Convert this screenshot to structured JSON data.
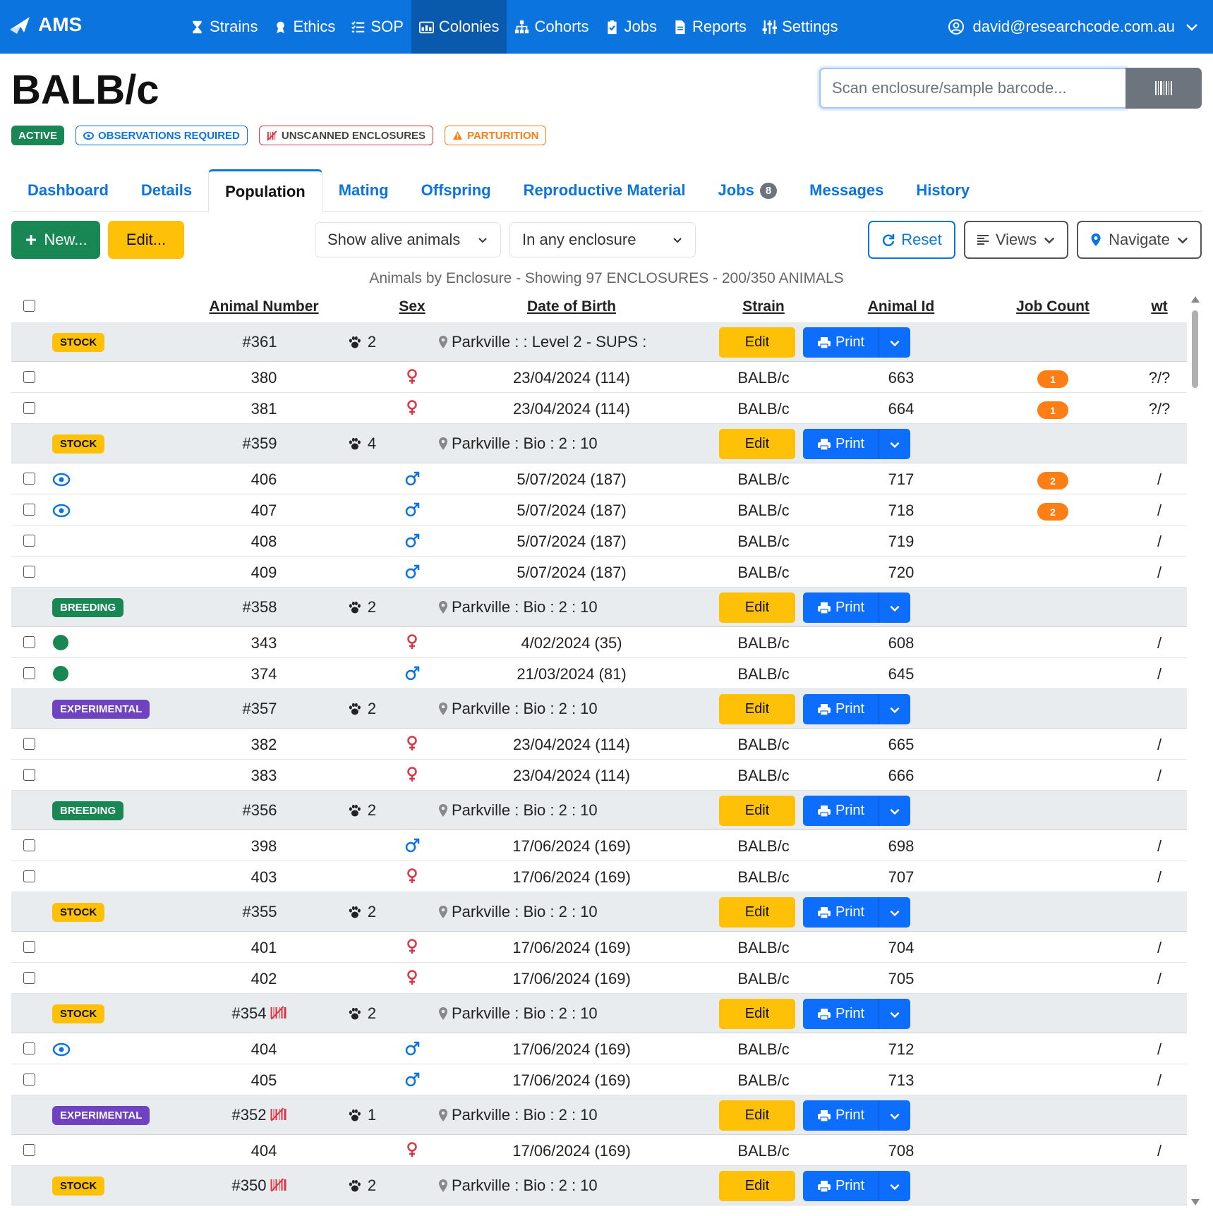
{
  "nav": {
    "brand": "AMS",
    "items": [
      {
        "label": "Strains",
        "icon": "hourglass-icon"
      },
      {
        "label": "Ethics",
        "icon": "award-icon"
      },
      {
        "label": "SOP",
        "icon": "list-check-icon"
      },
      {
        "label": "Colonies",
        "icon": "colony-icon"
      },
      {
        "label": "Cohorts",
        "icon": "sitemap-icon"
      },
      {
        "label": "Jobs",
        "icon": "clipboard-check-icon"
      },
      {
        "label": "Reports",
        "icon": "file-icon"
      },
      {
        "label": "Settings",
        "icon": "sliders-icon"
      }
    ],
    "active": "Colonies",
    "user": "david@researchcode.com.au"
  },
  "page": {
    "title": "BALB/c",
    "badges": {
      "active": "ACTIVE",
      "observations": "OBSERVATIONS REQUIRED",
      "unscanned": "UNSCANNED ENCLOSURES",
      "parturition": "PARTURITION"
    },
    "scan_placeholder": "Scan enclosure/sample barcode..."
  },
  "tabs": {
    "dashboard": "Dashboard",
    "details": "Details",
    "population": "Population",
    "mating": "Mating",
    "offspring": "Offspring",
    "repro": "Reproductive Material",
    "jobs": "Jobs",
    "jobs_count": "8",
    "messages": "Messages",
    "history": "History"
  },
  "toolbar": {
    "new": "New...",
    "edit": "Edit...",
    "filter_alive": "Show alive animals",
    "filter_enclosure": "In any enclosure",
    "reset": "Reset",
    "views": "Views",
    "navigate": "Navigate"
  },
  "caption": "Animals by Enclosure - Showing 97 ENCLOSURES - 200/350 ANIMALS",
  "columns": {
    "animal_number": "Animal Number",
    "sex": "Sex",
    "dob": "Date of Birth",
    "strain": "Strain",
    "animal_id": "Animal Id",
    "job_count": "Job Count",
    "wt": "wt"
  },
  "group_buttons": {
    "edit": "Edit",
    "print": "Print"
  },
  "colors": {
    "primary": "#0b74de",
    "success": "#198754",
    "warning": "#ffc107",
    "danger": "#dc3545",
    "orange": "#fd7e14",
    "purple": "#6f42c1"
  },
  "groups": [
    {
      "type": "STOCK",
      "enclosure": "#361",
      "count": "2",
      "location": "Parkville : : Level 2 - SUPS :",
      "unscanned": false,
      "animals": [
        {
          "number": "380",
          "sex": "female",
          "dob": "23/04/2024 (114)",
          "strain": "BALB/c",
          "id": "663",
          "jobs": "1",
          "wt": "?/?"
        },
        {
          "number": "381",
          "sex": "female",
          "dob": "23/04/2024 (114)",
          "strain": "BALB/c",
          "id": "664",
          "jobs": "1",
          "wt": "?/?"
        }
      ]
    },
    {
      "type": "STOCK",
      "enclosure": "#359",
      "count": "4",
      "location": "Parkville : Bio : 2 : 10",
      "unscanned": false,
      "animals": [
        {
          "number": "406",
          "sex": "male",
          "dob": "5/07/2024 (187)",
          "strain": "BALB/c",
          "id": "717",
          "jobs": "2",
          "wt": "/",
          "flag": "eye"
        },
        {
          "number": "407",
          "sex": "male",
          "dob": "5/07/2024 (187)",
          "strain": "BALB/c",
          "id": "718",
          "jobs": "2",
          "wt": "/",
          "flag": "eye"
        },
        {
          "number": "408",
          "sex": "male",
          "dob": "5/07/2024 (187)",
          "strain": "BALB/c",
          "id": "719",
          "jobs": "",
          "wt": "/"
        },
        {
          "number": "409",
          "sex": "male",
          "dob": "5/07/2024 (187)",
          "strain": "BALB/c",
          "id": "720",
          "jobs": "",
          "wt": "/"
        }
      ]
    },
    {
      "type": "BREEDING",
      "enclosure": "#358",
      "count": "2",
      "location": "Parkville : Bio : 2 : 10",
      "unscanned": false,
      "animals": [
        {
          "number": "343",
          "sex": "female",
          "dob": "4/02/2024 (35)",
          "strain": "BALB/c",
          "id": "608",
          "jobs": "",
          "wt": "/",
          "flag": "dot"
        },
        {
          "number": "374",
          "sex": "male",
          "dob": "21/03/2024 (81)",
          "strain": "BALB/c",
          "id": "645",
          "jobs": "",
          "wt": "/",
          "flag": "dot"
        }
      ]
    },
    {
      "type": "EXPERIMENTAL",
      "enclosure": "#357",
      "count": "2",
      "location": "Parkville : Bio : 2 : 10",
      "unscanned": false,
      "animals": [
        {
          "number": "382",
          "sex": "female",
          "dob": "23/04/2024 (114)",
          "strain": "BALB/c",
          "id": "665",
          "jobs": "",
          "wt": "/"
        },
        {
          "number": "383",
          "sex": "female",
          "dob": "23/04/2024 (114)",
          "strain": "BALB/c",
          "id": "666",
          "jobs": "",
          "wt": "/"
        }
      ]
    },
    {
      "type": "BREEDING",
      "enclosure": "#356",
      "count": "2",
      "location": "Parkville : Bio : 2 : 10",
      "unscanned": false,
      "animals": [
        {
          "number": "398",
          "sex": "male",
          "dob": "17/06/2024 (169)",
          "strain": "BALB/c",
          "id": "698",
          "jobs": "",
          "wt": "/"
        },
        {
          "number": "403",
          "sex": "female",
          "dob": "17/06/2024 (169)",
          "strain": "BALB/c",
          "id": "707",
          "jobs": "",
          "wt": "/"
        }
      ]
    },
    {
      "type": "STOCK",
      "enclosure": "#355",
      "count": "2",
      "location": "Parkville : Bio : 2 : 10",
      "unscanned": false,
      "animals": [
        {
          "number": "401",
          "sex": "female",
          "dob": "17/06/2024 (169)",
          "strain": "BALB/c",
          "id": "704",
          "jobs": "",
          "wt": "/"
        },
        {
          "number": "402",
          "sex": "female",
          "dob": "17/06/2024 (169)",
          "strain": "BALB/c",
          "id": "705",
          "jobs": "",
          "wt": "/"
        }
      ]
    },
    {
      "type": "STOCK",
      "enclosure": "#354",
      "count": "2",
      "location": "Parkville : Bio : 2 : 10",
      "unscanned": true,
      "animals": [
        {
          "number": "404",
          "sex": "male",
          "dob": "17/06/2024 (169)",
          "strain": "BALB/c",
          "id": "712",
          "jobs": "",
          "wt": "/",
          "flag": "eye"
        },
        {
          "number": "405",
          "sex": "male",
          "dob": "17/06/2024 (169)",
          "strain": "BALB/c",
          "id": "713",
          "jobs": "",
          "wt": "/"
        }
      ]
    },
    {
      "type": "EXPERIMENTAL",
      "enclosure": "#352",
      "count": "1",
      "location": "Parkville : Bio : 2 : 10",
      "unscanned": true,
      "animals": [
        {
          "number": "404",
          "sex": "female",
          "dob": "17/06/2024 (169)",
          "strain": "BALB/c",
          "id": "708",
          "jobs": "",
          "wt": "/"
        }
      ]
    },
    {
      "type": "STOCK",
      "enclosure": "#350",
      "count": "2",
      "location": "Parkville : Bio : 2 : 10",
      "unscanned": true,
      "animals": []
    }
  ]
}
